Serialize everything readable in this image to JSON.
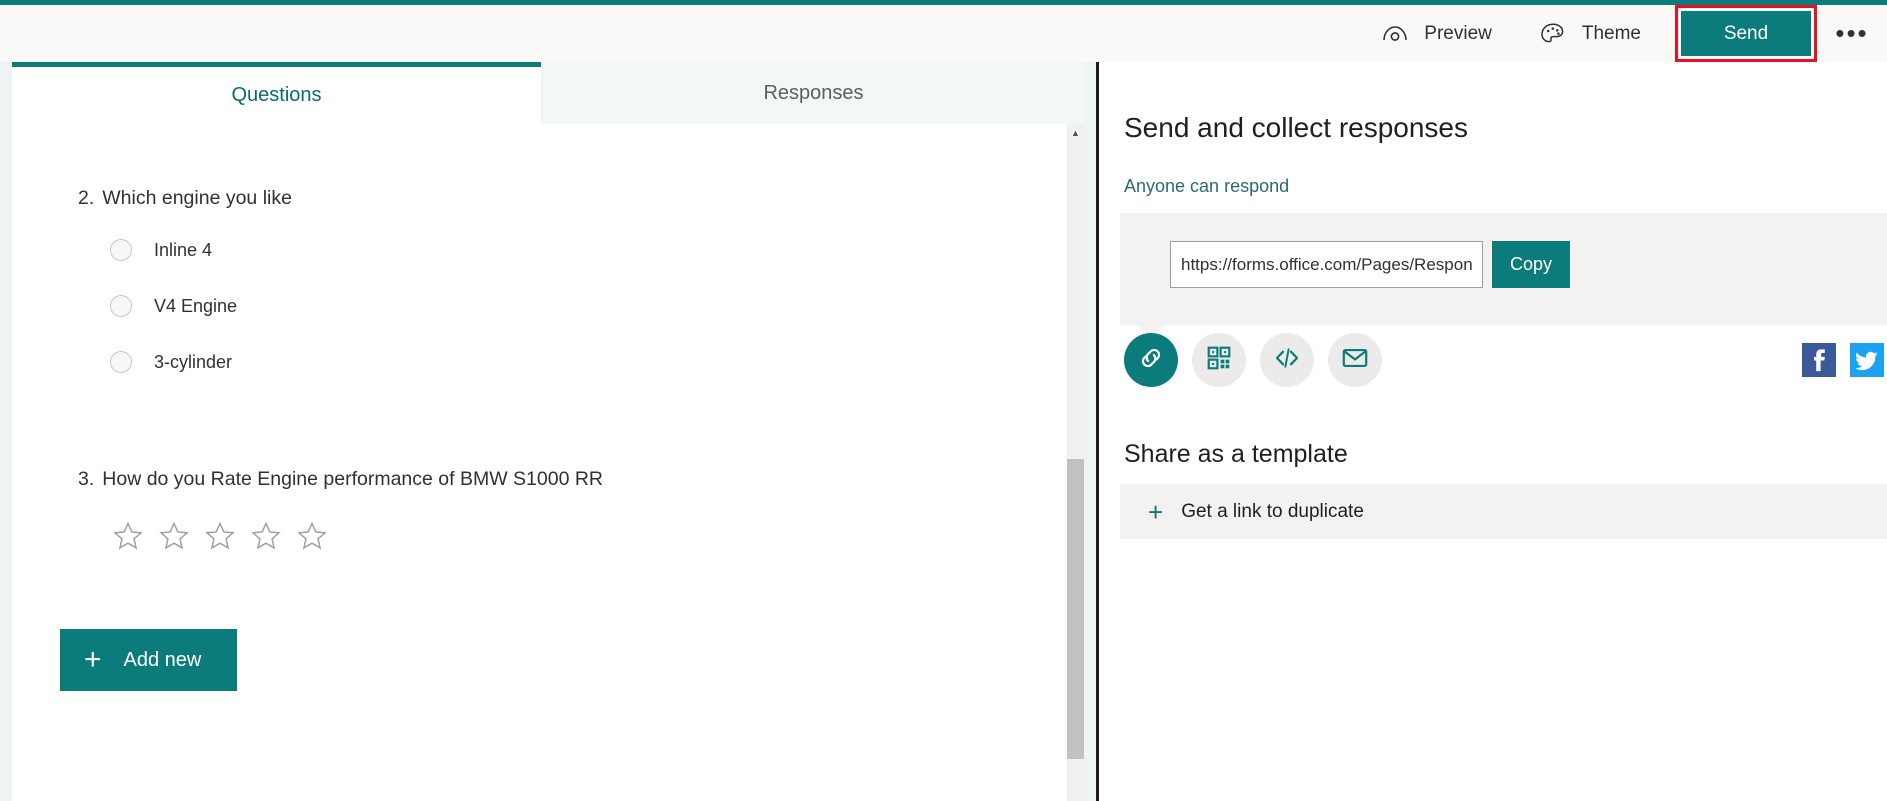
{
  "accent_color": "#0b7b7b",
  "highlight_color": "#e81123",
  "commandbar": {
    "preview_label": "Preview",
    "preview_icon": "eye-icon",
    "theme_label": "Theme",
    "theme_icon": "palette-icon",
    "send_label": "Send",
    "more_label": "•••",
    "more_icon": "ellipsis-icon"
  },
  "tabs": [
    {
      "label": "Questions",
      "active": true
    },
    {
      "label": "Responses",
      "active": false
    }
  ],
  "form": {
    "questions": [
      {
        "number": "2.",
        "title": "Which engine you like",
        "type": "choice",
        "options": [
          "Inline 4",
          "V4 Engine",
          "3-cylinder"
        ]
      },
      {
        "number": "3.",
        "title": "How do you Rate Engine performance of BMW S1000 RR",
        "type": "rating",
        "stars": 5
      }
    ],
    "add_new_label": "Add new",
    "add_new_icon": "plus-icon"
  },
  "panel": {
    "title": "Send and collect responses",
    "audience_link": "Anyone can respond",
    "url_value": "https://forms.office.com/Pages/Respon",
    "url_placeholder": "https://forms.office.com/Pages/Respon",
    "copy_label": "Copy",
    "share_options": [
      {
        "icon": "link-icon",
        "selected": true
      },
      {
        "icon": "qr-code-icon",
        "selected": false
      },
      {
        "icon": "embed-code-icon",
        "selected": false
      },
      {
        "icon": "email-icon",
        "selected": false
      }
    ],
    "social": [
      {
        "icon": "facebook-icon",
        "color": "#3b5998"
      },
      {
        "icon": "twitter-icon",
        "color": "#1da1f2"
      }
    ],
    "template_title": "Share as a template",
    "template_link_label": "Get a link to duplicate",
    "template_plus_icon": "plus-icon"
  },
  "scrollbar": {
    "up_arrow_icon": "caret-up-icon"
  }
}
